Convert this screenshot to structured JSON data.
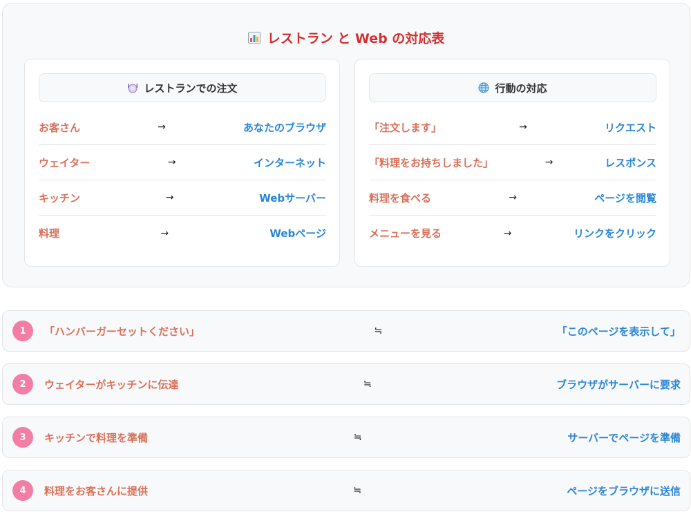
{
  "title": "レストラン と Web の対応表",
  "icons": {
    "title": "bar-chart-icon",
    "left_card": "plate-icon",
    "right_card": "globe-icon"
  },
  "colors": {
    "title": "#d32f2f",
    "left_text": "#d9705a",
    "right_text": "#2b86d6",
    "step_badge": "#f37ea5"
  },
  "restaurant_card": {
    "header": "レストランでの注文",
    "rows": [
      {
        "left": "お客さん",
        "arrow": "→",
        "right": "あなたのブラウザ"
      },
      {
        "left": "ウェイター",
        "arrow": "→",
        "right": "インターネット"
      },
      {
        "left": "キッチン",
        "arrow": "→",
        "right": "Webサーバー"
      },
      {
        "left": "料理",
        "arrow": "→",
        "right": "Webページ"
      }
    ]
  },
  "action_card": {
    "header": "行動の対応",
    "rows": [
      {
        "left": "「注文します」",
        "arrow": "→",
        "right": "リクエスト"
      },
      {
        "left": "「料理をお持ちしました」",
        "arrow": "→",
        "right": "レスポンス"
      },
      {
        "left": "料理を食べる",
        "arrow": "→",
        "right": "ページを閲覧"
      },
      {
        "left": "メニューを見る",
        "arrow": "→",
        "right": "リンクをクリック"
      }
    ]
  },
  "steps": [
    {
      "num": "1",
      "left": "「ハンバーガーセットください」",
      "symbol": "≒",
      "right": "「このページを表示して」"
    },
    {
      "num": "2",
      "left": "ウェイターがキッチンに伝達",
      "symbol": "≒",
      "right": "ブラウザがサーバーに要求"
    },
    {
      "num": "3",
      "left": "キッチンで料理を準備",
      "symbol": "≒",
      "right": "サーバーでページを準備"
    },
    {
      "num": "4",
      "left": "料理をお客さんに提供",
      "symbol": "≒",
      "right": "ページをブラウザに送信"
    }
  ]
}
